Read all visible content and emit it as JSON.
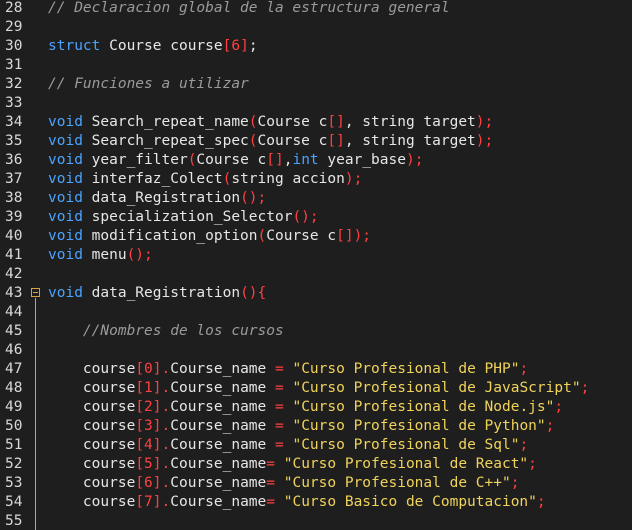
{
  "editor": {
    "lines": [
      {
        "num": "28",
        "tokens": [
          {
            "t": "cm",
            "v": "// Declaracion global de la estructura general"
          }
        ]
      },
      {
        "num": "29",
        "tokens": []
      },
      {
        "num": "30",
        "tokens": [
          {
            "t": "kw",
            "v": "struct"
          },
          {
            "t": "tx",
            "v": " Course course"
          },
          {
            "t": "pn",
            "v": "[6]"
          },
          {
            "t": "tx",
            "v": ";"
          }
        ]
      },
      {
        "num": "31",
        "tokens": []
      },
      {
        "num": "32",
        "tokens": [
          {
            "t": "cm",
            "v": "// Funciones a utilizar"
          }
        ]
      },
      {
        "num": "33",
        "tokens": []
      },
      {
        "num": "34",
        "tokens": [
          {
            "t": "kw",
            "v": "void"
          },
          {
            "t": "tx",
            "v": " Search_repeat_name"
          },
          {
            "t": "pn",
            "v": "("
          },
          {
            "t": "tx",
            "v": "Course c"
          },
          {
            "t": "pn",
            "v": "[]"
          },
          {
            "t": "tx",
            "v": ", string target"
          },
          {
            "t": "pn",
            "v": ");"
          }
        ]
      },
      {
        "num": "35",
        "tokens": [
          {
            "t": "kw",
            "v": "void"
          },
          {
            "t": "tx",
            "v": " Search_repeat_spec"
          },
          {
            "t": "pn",
            "v": "("
          },
          {
            "t": "tx",
            "v": "Course c"
          },
          {
            "t": "pn",
            "v": "[]"
          },
          {
            "t": "tx",
            "v": ", string target"
          },
          {
            "t": "pn",
            "v": ");"
          }
        ]
      },
      {
        "num": "36",
        "tokens": [
          {
            "t": "kw",
            "v": "void"
          },
          {
            "t": "tx",
            "v": " year_filter"
          },
          {
            "t": "pn",
            "v": "("
          },
          {
            "t": "tx",
            "v": "Course c"
          },
          {
            "t": "pn",
            "v": "[]"
          },
          {
            "t": "tx",
            "v": ","
          },
          {
            "t": "kw",
            "v": "int"
          },
          {
            "t": "tx",
            "v": " year_base"
          },
          {
            "t": "pn",
            "v": ");"
          }
        ]
      },
      {
        "num": "37",
        "tokens": [
          {
            "t": "kw",
            "v": "void"
          },
          {
            "t": "tx",
            "v": " interfaz_Colect"
          },
          {
            "t": "pn",
            "v": "("
          },
          {
            "t": "tx",
            "v": "string accion"
          },
          {
            "t": "pn",
            "v": ");"
          }
        ]
      },
      {
        "num": "38",
        "tokens": [
          {
            "t": "kw",
            "v": "void"
          },
          {
            "t": "tx",
            "v": " data_Registration"
          },
          {
            "t": "pn",
            "v": "();"
          }
        ]
      },
      {
        "num": "39",
        "tokens": [
          {
            "t": "kw",
            "v": "void"
          },
          {
            "t": "tx",
            "v": " specialization_Selector"
          },
          {
            "t": "pn",
            "v": "();"
          }
        ]
      },
      {
        "num": "40",
        "tokens": [
          {
            "t": "kw",
            "v": "void"
          },
          {
            "t": "tx",
            "v": " modification_option"
          },
          {
            "t": "pn",
            "v": "("
          },
          {
            "t": "tx",
            "v": "Course c"
          },
          {
            "t": "pn",
            "v": "[]);"
          }
        ]
      },
      {
        "num": "41",
        "tokens": [
          {
            "t": "kw",
            "v": "void"
          },
          {
            "t": "tx",
            "v": " menu"
          },
          {
            "t": "pn",
            "v": "();"
          }
        ]
      },
      {
        "num": "42",
        "tokens": []
      },
      {
        "num": "43",
        "fold": true,
        "tokens": [
          {
            "t": "kw",
            "v": "void"
          },
          {
            "t": "tx",
            "v": " data_Registration"
          },
          {
            "t": "pn",
            "v": "(){"
          }
        ]
      },
      {
        "num": "44",
        "tokens": []
      },
      {
        "num": "45",
        "tokens": [
          {
            "t": "cm",
            "v": "    //Nombres de los cursos"
          }
        ]
      },
      {
        "num": "46",
        "tokens": []
      },
      {
        "num": "47",
        "tokens": [
          {
            "t": "tx",
            "v": "    course"
          },
          {
            "t": "pn",
            "v": "[0]."
          },
          {
            "t": "tx",
            "v": "Course_name "
          },
          {
            "t": "pn",
            "v": "="
          },
          {
            "t": "tx",
            "v": " "
          },
          {
            "t": "st",
            "v": "\"Curso Profesional de PHP\""
          },
          {
            "t": "pn",
            "v": ";"
          }
        ]
      },
      {
        "num": "48",
        "tokens": [
          {
            "t": "tx",
            "v": "    course"
          },
          {
            "t": "pn",
            "v": "[1]."
          },
          {
            "t": "tx",
            "v": "Course_name "
          },
          {
            "t": "pn",
            "v": "="
          },
          {
            "t": "tx",
            "v": " "
          },
          {
            "t": "st",
            "v": "\"Curso Profesional de JavaScript\""
          },
          {
            "t": "pn",
            "v": ";"
          }
        ]
      },
      {
        "num": "49",
        "tokens": [
          {
            "t": "tx",
            "v": "    course"
          },
          {
            "t": "pn",
            "v": "[2]."
          },
          {
            "t": "tx",
            "v": "Course_name "
          },
          {
            "t": "pn",
            "v": "="
          },
          {
            "t": "tx",
            "v": " "
          },
          {
            "t": "st",
            "v": "\"Curso Profesional de Node.js\""
          },
          {
            "t": "pn",
            "v": ";"
          }
        ]
      },
      {
        "num": "50",
        "tokens": [
          {
            "t": "tx",
            "v": "    course"
          },
          {
            "t": "pn",
            "v": "[3]."
          },
          {
            "t": "tx",
            "v": "Course_name "
          },
          {
            "t": "pn",
            "v": "="
          },
          {
            "t": "tx",
            "v": " "
          },
          {
            "t": "st",
            "v": "\"Curso Profesional de Python\""
          },
          {
            "t": "pn",
            "v": ";"
          }
        ]
      },
      {
        "num": "51",
        "tokens": [
          {
            "t": "tx",
            "v": "    course"
          },
          {
            "t": "pn",
            "v": "[4]."
          },
          {
            "t": "tx",
            "v": "Course_name "
          },
          {
            "t": "pn",
            "v": "="
          },
          {
            "t": "tx",
            "v": " "
          },
          {
            "t": "st",
            "v": "\"Curso Profesional de Sql\""
          },
          {
            "t": "pn",
            "v": ";"
          }
        ]
      },
      {
        "num": "52",
        "tokens": [
          {
            "t": "tx",
            "v": "    course"
          },
          {
            "t": "pn",
            "v": "[5]."
          },
          {
            "t": "tx",
            "v": "Course_name"
          },
          {
            "t": "pn",
            "v": "="
          },
          {
            "t": "tx",
            "v": " "
          },
          {
            "t": "st",
            "v": "\"Curso Profesional de React\""
          },
          {
            "t": "pn",
            "v": ";"
          }
        ]
      },
      {
        "num": "53",
        "tokens": [
          {
            "t": "tx",
            "v": "    course"
          },
          {
            "t": "pn",
            "v": "[6]."
          },
          {
            "t": "tx",
            "v": "Course_name"
          },
          {
            "t": "pn",
            "v": "="
          },
          {
            "t": "tx",
            "v": " "
          },
          {
            "t": "st",
            "v": "\"Curso Profesional de C++\""
          },
          {
            "t": "pn",
            "v": ";"
          }
        ]
      },
      {
        "num": "54",
        "tokens": [
          {
            "t": "tx",
            "v": "    course"
          },
          {
            "t": "pn",
            "v": "[7]."
          },
          {
            "t": "tx",
            "v": "Course_name"
          },
          {
            "t": "pn",
            "v": "="
          },
          {
            "t": "tx",
            "v": " "
          },
          {
            "t": "st",
            "v": "\"Curso Basico de Computacion\""
          },
          {
            "t": "pn",
            "v": ";"
          }
        ]
      },
      {
        "num": "55",
        "tokens": []
      }
    ]
  },
  "colors": {
    "background": "#1e1e1e",
    "keyword": "#4aa3ff",
    "comment": "#9a9a9a",
    "punctuation": "#ff4040",
    "string": "#f0d35a",
    "fold_marker": "#d6a23c"
  }
}
